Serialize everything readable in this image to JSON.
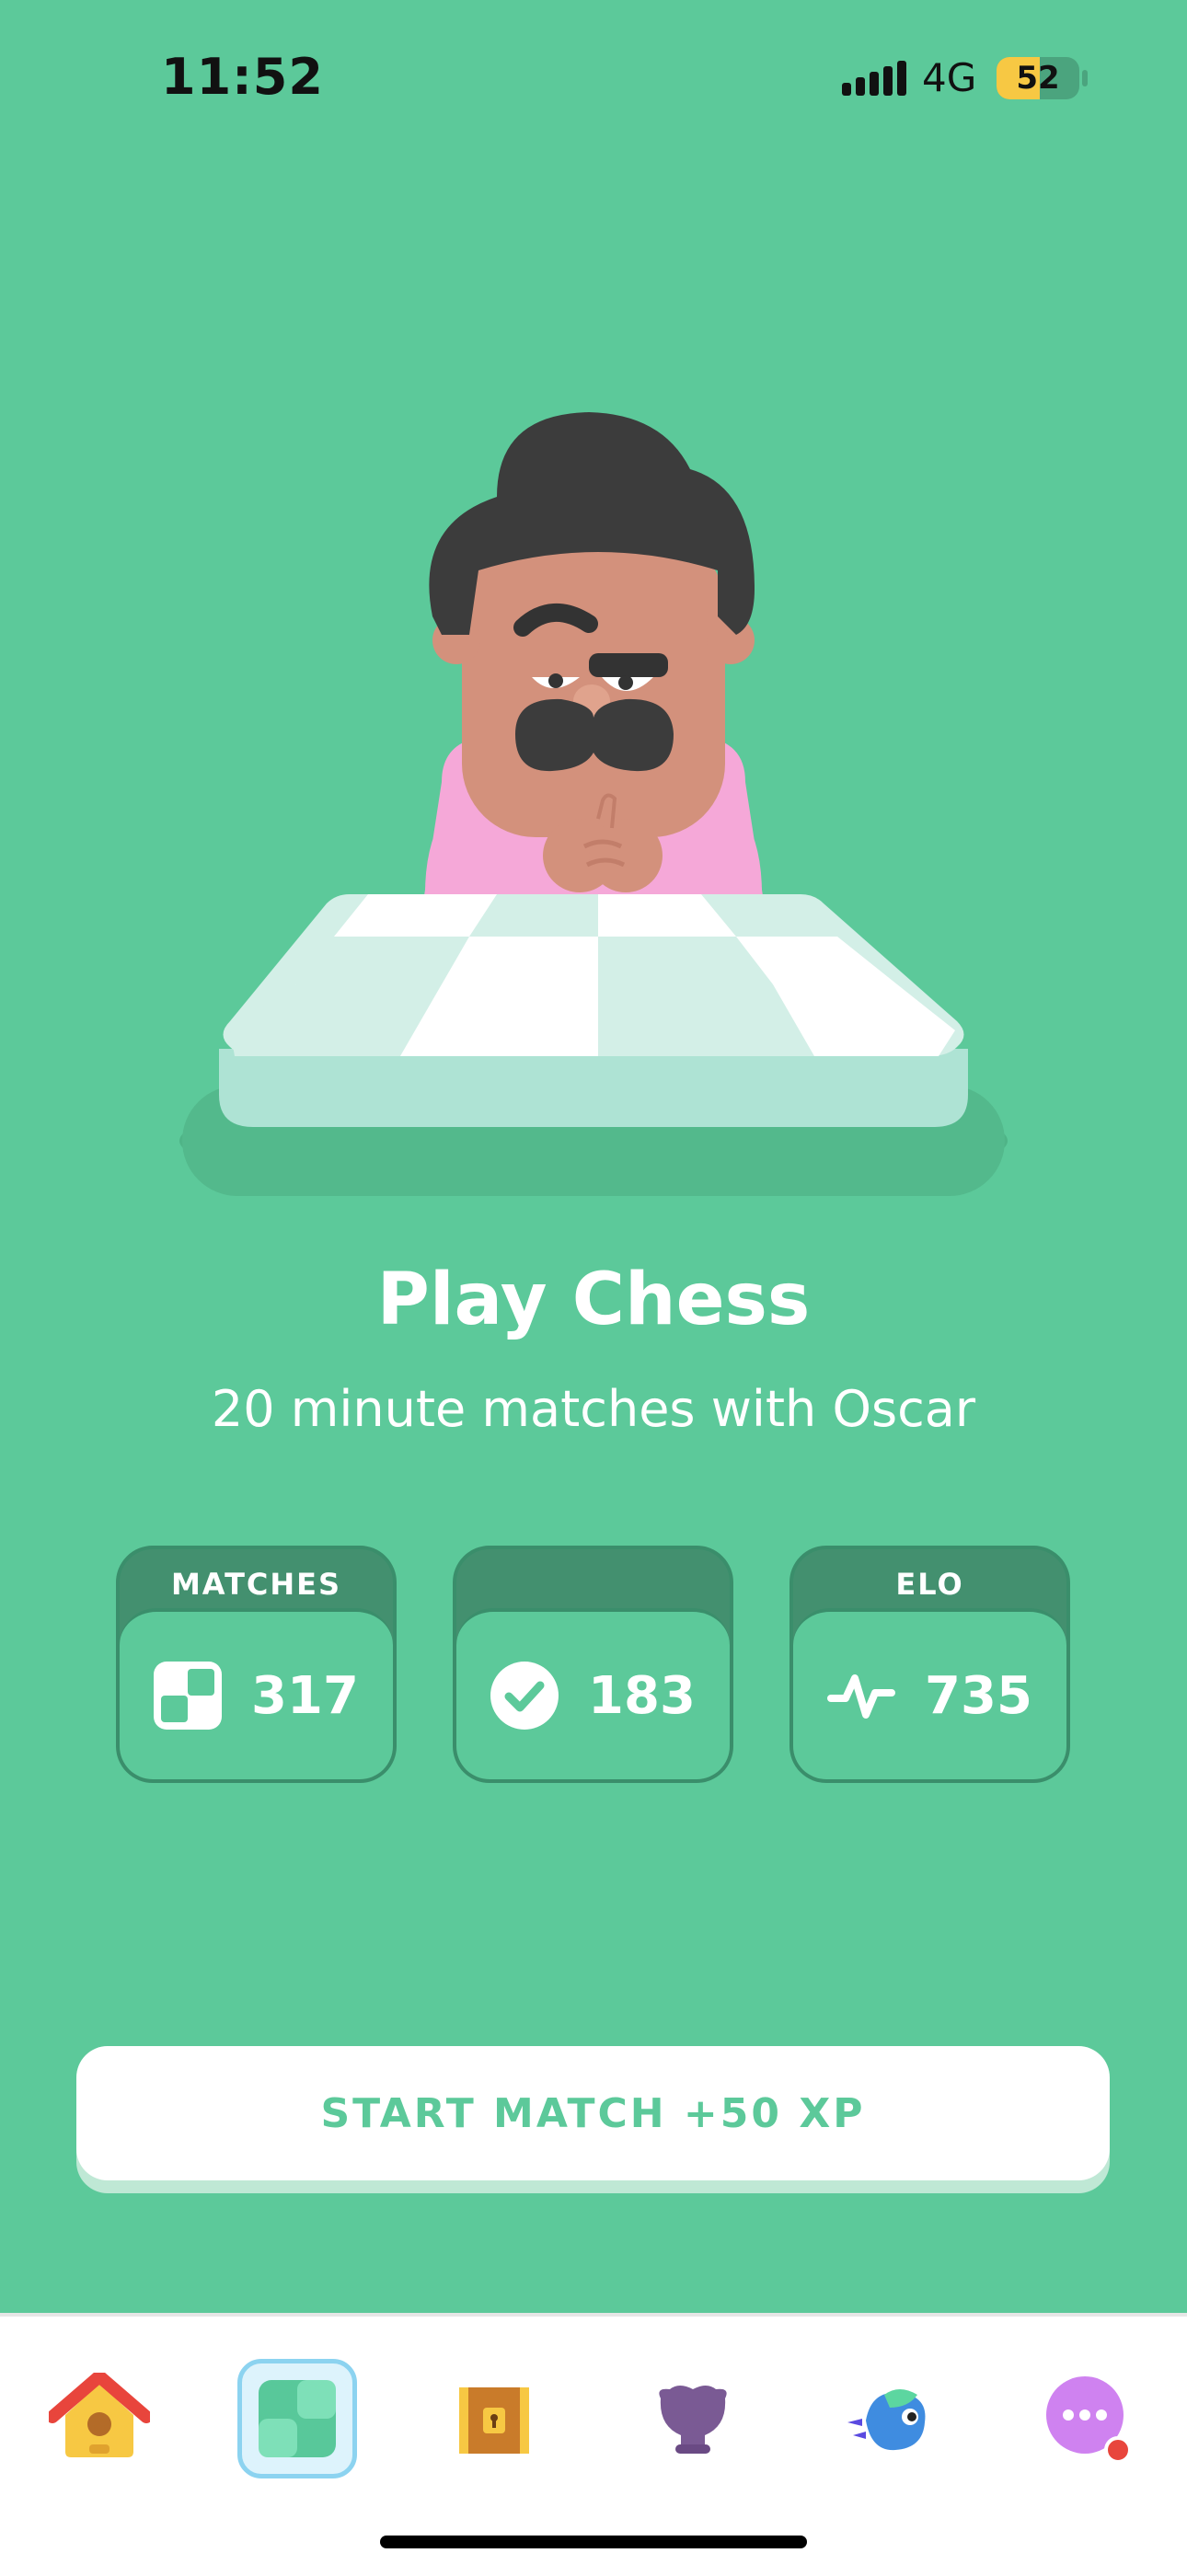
{
  "status_bar": {
    "time": "11:52",
    "network": "4G",
    "battery": "52",
    "battery_level": 0.52
  },
  "main": {
    "title": "Play Chess",
    "subtitle": "20 minute matches with Oscar",
    "character_icon": "oscar-character",
    "board_icon": "chessboard"
  },
  "stats": [
    {
      "label": "MATCHES",
      "value": "317",
      "icon": "chessboard-icon"
    },
    {
      "label": "",
      "value": "183",
      "icon": "check-circle-icon"
    },
    {
      "label": "ELO",
      "value": "735",
      "icon": "pulse-icon"
    }
  ],
  "cta": {
    "label": "START MATCH +50 XP"
  },
  "tabs": [
    {
      "icon": "home-icon",
      "active": false
    },
    {
      "icon": "chess-icon",
      "active": true
    },
    {
      "icon": "treasure-chest-icon",
      "active": false
    },
    {
      "icon": "trophy-icon",
      "active": false
    },
    {
      "icon": "character-icon",
      "active": false
    },
    {
      "icon": "more-icon",
      "active": false,
      "badge": true
    }
  ],
  "colors": {
    "background": "#5CC99A",
    "accent": "#5CC99A",
    "dark": "#43906F",
    "button": "#FFFFFF"
  }
}
